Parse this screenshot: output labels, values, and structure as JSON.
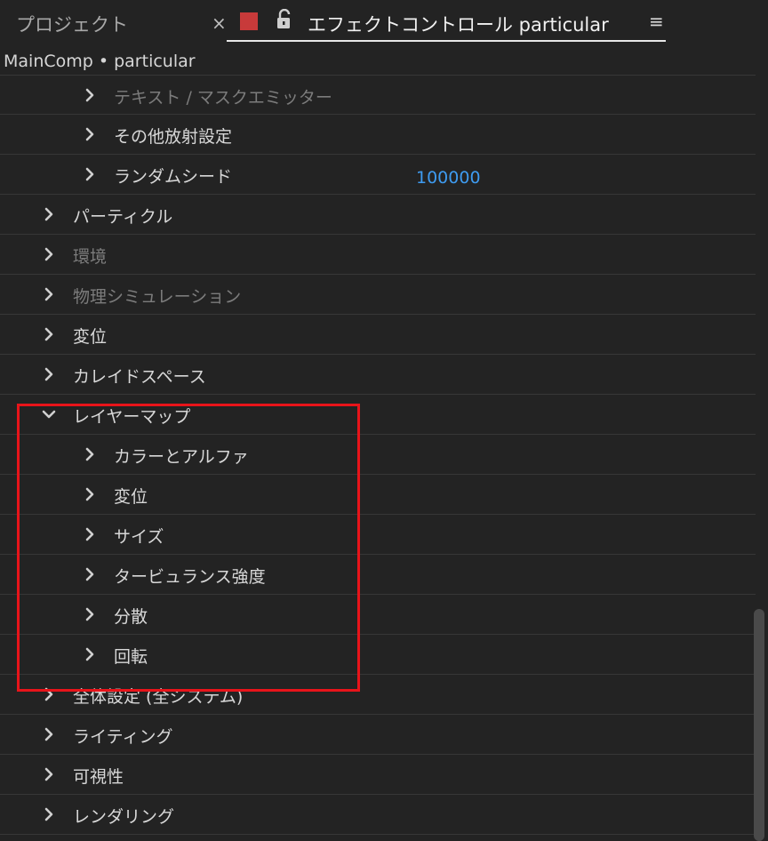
{
  "tabs": {
    "project_label": "プロジェクト",
    "close_glyph": "×",
    "effect_controls_label": "エフェクトコントロール particular",
    "menu_glyph": "≡",
    "swatch_color": "#c83a3a"
  },
  "breadcrumb": "MainComp • particular",
  "rows": [
    {
      "label": "テキスト / マスクエミッター",
      "level": 2,
      "expanded": false,
      "dim": true
    },
    {
      "label": "その他放射設定",
      "level": 2,
      "expanded": false,
      "dim": false
    },
    {
      "label": "ランダムシード",
      "level": 2,
      "expanded": false,
      "dim": false,
      "value": "100000"
    },
    {
      "label": "パーティクル",
      "level": 1,
      "expanded": false,
      "dim": false
    },
    {
      "label": "環境",
      "level": 1,
      "expanded": false,
      "dim": true
    },
    {
      "label": "物理シミュレーション",
      "level": 1,
      "expanded": false,
      "dim": true
    },
    {
      "label": "変位",
      "level": 1,
      "expanded": false,
      "dim": false
    },
    {
      "label": "カレイドスペース",
      "level": 1,
      "expanded": false,
      "dim": false
    },
    {
      "label": "レイヤーマップ",
      "level": 1,
      "expanded": true,
      "dim": false
    },
    {
      "label": "カラーとアルファ",
      "level": 2,
      "expanded": false,
      "dim": false
    },
    {
      "label": "変位",
      "level": 2,
      "expanded": false,
      "dim": false
    },
    {
      "label": "サイズ",
      "level": 2,
      "expanded": false,
      "dim": false
    },
    {
      "label": "タービュランス強度",
      "level": 2,
      "expanded": false,
      "dim": false
    },
    {
      "label": "分散",
      "level": 2,
      "expanded": false,
      "dim": false
    },
    {
      "label": "回転",
      "level": 2,
      "expanded": false,
      "dim": false
    },
    {
      "label": "全体設定 (全システム)",
      "level": 1,
      "expanded": false,
      "dim": false
    },
    {
      "label": "ライティング",
      "level": 1,
      "expanded": false,
      "dim": false
    },
    {
      "label": "可視性",
      "level": 1,
      "expanded": false,
      "dim": false
    },
    {
      "label": "レンダリング",
      "level": 1,
      "expanded": false,
      "dim": false
    }
  ],
  "colors": {
    "background": "#232323",
    "value_blue": "#3e9bf0",
    "highlight_red": "#e8141a"
  }
}
